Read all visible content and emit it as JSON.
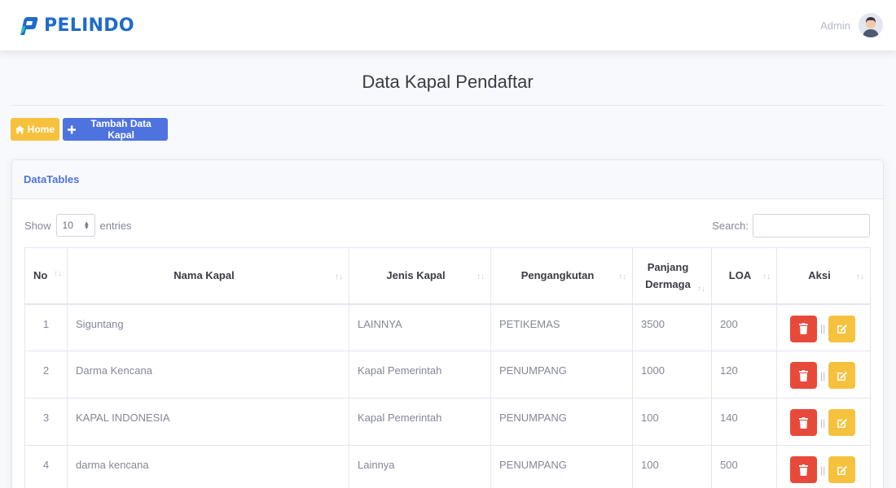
{
  "brand": {
    "name": "PELINDO"
  },
  "user": {
    "name": "Admin"
  },
  "page": {
    "title": "Data Kapal Pendaftar"
  },
  "buttons": {
    "home": "Home",
    "add": "Tambah Data Kapal"
  },
  "card": {
    "title": "DataTables"
  },
  "datatable": {
    "show_label": "Show",
    "entries_label": "entries",
    "page_length": "10",
    "search_label": "Search:",
    "search_value": ""
  },
  "table": {
    "headers": {
      "no": "No",
      "nama": "Nama Kapal",
      "jenis": "Jenis Kapal",
      "pengangkutan": "Pengangkutan",
      "panjang_1": "Panjang",
      "panjang_2": "Dermaga",
      "loa": "LOA",
      "aksi": "Aksi"
    },
    "rows": [
      {
        "no": "1",
        "nama": "Siguntang",
        "jenis": "LAINNYA",
        "pengangkutan": "PETIKEMAS",
        "panjang": "3500",
        "loa": "200"
      },
      {
        "no": "2",
        "nama": "Darma Kencana",
        "jenis": "Kapal Pemerintah",
        "pengangkutan": "PENUMPANG",
        "panjang": "1000",
        "loa": "120"
      },
      {
        "no": "3",
        "nama": "KAPAL INDONESIA",
        "jenis": "Kapal Pemerintah",
        "pengangkutan": "PENUMPANG",
        "panjang": "100",
        "loa": "140"
      },
      {
        "no": "4",
        "nama": "darma kencana",
        "jenis": "Lainnya",
        "pengangkutan": "PENUMPANG",
        "panjang": "100",
        "loa": "500"
      }
    ],
    "action_separator": "||"
  },
  "colors": {
    "primary": "#4e73df",
    "warning": "#f6c23e",
    "danger": "#e74a3b",
    "brand": "#1f6bc9"
  },
  "icons": {
    "home": "home-icon",
    "add": "plus-icon",
    "delete": "trash-icon",
    "edit": "edit-icon",
    "sort": "sort-icon"
  }
}
